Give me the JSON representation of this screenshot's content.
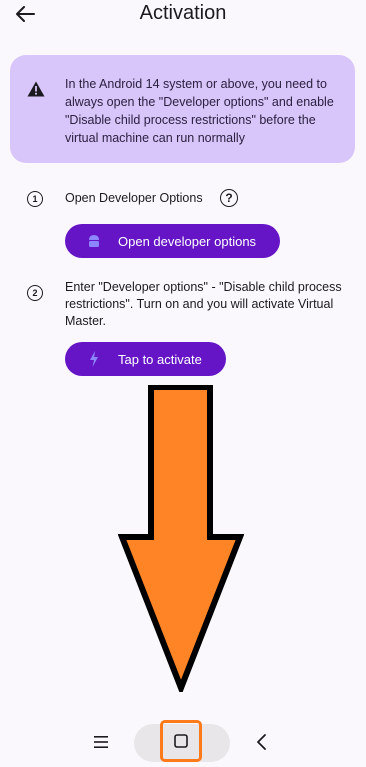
{
  "header": {
    "title": "Activation",
    "back_icon": "arrow-left-icon"
  },
  "warning": {
    "icon": "warning-triangle-icon",
    "text": "In the Android 14 system or above, you need to always open the \"Developer options\" and enable \"Disable child process restrictions\" before the virtual machine can run normally",
    "background": "#d8c5fa"
  },
  "steps": [
    {
      "number": "1",
      "text": "Open Developer Options",
      "help_icon": "question-circle-icon",
      "help_glyph": "?",
      "button": {
        "label": "Open developer options",
        "icon": "android-icon"
      }
    },
    {
      "number": "2",
      "text": "Enter \"Developer options\" - \"Disable child process restrictions\". Turn on and you will activate Virtual Master.",
      "button": {
        "label": "Tap to activate",
        "icon": "lightning-icon"
      }
    }
  ],
  "overlay": {
    "arrow_color": "#ff8426",
    "arrow_outline": "#000000"
  },
  "navbar": {
    "menu_icon": "menu-icon",
    "home_icon": "home-square-icon",
    "back_icon": "back-chevron-icon",
    "highlight_color": "#ff7a1a"
  },
  "colors": {
    "accent": "#6515c6",
    "background": "#fbf8fd"
  }
}
